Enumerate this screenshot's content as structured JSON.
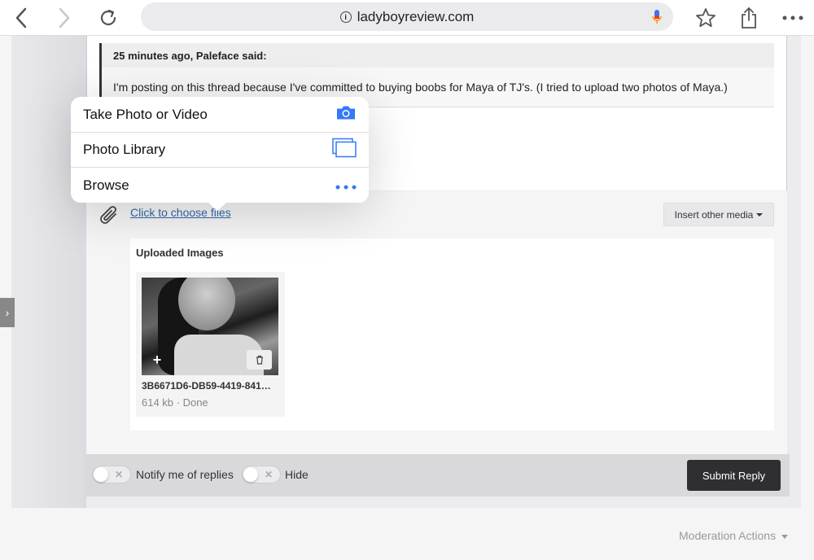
{
  "browser": {
    "url": "ladyboyreview.com",
    "colors": {
      "accent": "#3478f6"
    }
  },
  "quote": {
    "header": "25 minutes ago, Paleface said:",
    "body": "I'm posting on this thread because I've committed to buying boobs for Maya of TJ's. (I tried to upload two photos of Maya.)"
  },
  "attachments": {
    "choose_files_link": "Click to choose files",
    "insert_media_label": "Insert other media",
    "uploaded_title": "Uploaded Images",
    "file": {
      "name": "3B6671D6-DB59-4419-841…",
      "meta": "614 kb · Done"
    }
  },
  "popover": {
    "items": [
      {
        "label": "Take Photo or Video",
        "icon": "camera-icon"
      },
      {
        "label": "Photo Library",
        "icon": "photo-library-icon"
      },
      {
        "label": "Browse",
        "icon": "more-icon"
      }
    ]
  },
  "footer": {
    "notify_label": "Notify me of replies",
    "hide_label": "Hide",
    "submit_label": "Submit Reply"
  },
  "moderation": {
    "label": "Moderation Actions"
  }
}
